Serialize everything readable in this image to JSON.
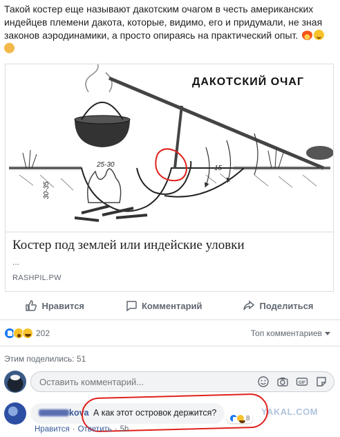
{
  "post": {
    "text": "Такой костер еще называют дакотским очагом в честь американских индейцев племени дакота, которые, видимо, его и придумали, не зная законов аэродинамики, а просто опираясь на практический опыт.",
    "emojis": [
      "fire",
      "smile",
      "hand"
    ]
  },
  "link": {
    "image_heading": "ДАКОТСКИЙ ОЧАГ",
    "dim_a": "25-30",
    "dim_b": "15",
    "dim_depth": "30-35",
    "title": "Костер под землей или индейские уловки",
    "desc": "...",
    "domain": "RASHPIL.PW"
  },
  "actions": {
    "like": "Нравится",
    "comment": "Комментарий",
    "share": "Поделиться"
  },
  "reactions": {
    "count": "202",
    "sort": "Топ комментариев"
  },
  "shares": "Этим поделились: 51",
  "composer": {
    "placeholder": "Оставить комментарий..."
  },
  "comment": {
    "author_suffix": "kova",
    "text": "А как этот островок держится?",
    "react_count": "8",
    "watermark": "YAKAL.COM"
  },
  "comment_actions": {
    "like": "Нравится",
    "dot": "·",
    "reply": "Ответить",
    "time": "5h"
  },
  "colors": {
    "link": "#385898",
    "muted": "#606770",
    "accent": "#1877f2",
    "highlight": "#e0201b"
  }
}
